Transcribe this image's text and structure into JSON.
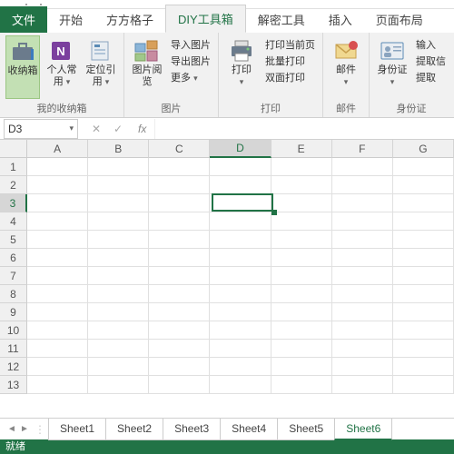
{
  "tabs": {
    "file": "文件",
    "items": [
      "开始",
      "方方格子",
      "DIY工具箱",
      "解密工具",
      "插入",
      "页面布局"
    ],
    "active_index": 2
  },
  "ribbon": {
    "group1": {
      "favorites": "收纳箱",
      "personal": "个人常用",
      "locate": "定位引用",
      "label": "我的收纳箱"
    },
    "group2": {
      "imgview": "图片阅览",
      "import_img": "导入图片",
      "export_img": "导出图片",
      "more": "更多",
      "label": "图片"
    },
    "group3": {
      "print": "打印",
      "print_current": "打印当前页",
      "batch_print": "批量打印",
      "duplex": "双面打印",
      "label": "打印"
    },
    "group4": {
      "mail": "邮件",
      "label": "邮件"
    },
    "group5": {
      "idcard": "身份证",
      "input": "输入",
      "extract1": "提取信",
      "extract2": "提取",
      "label": "身份证"
    }
  },
  "namebox": {
    "value": "D3",
    "fx": "fx"
  },
  "columns": [
    "A",
    "B",
    "C",
    "D",
    "E",
    "F",
    "G"
  ],
  "rows": [
    "1",
    "2",
    "3",
    "4",
    "5",
    "6",
    "7",
    "8",
    "9",
    "10",
    "11",
    "12",
    "13"
  ],
  "selected": {
    "col": "D",
    "row": "3"
  },
  "sheets": [
    "Sheet1",
    "Sheet2",
    "Sheet3",
    "Sheet4",
    "Sheet5",
    "Sheet6"
  ],
  "active_sheet": 5,
  "status": "就绪"
}
